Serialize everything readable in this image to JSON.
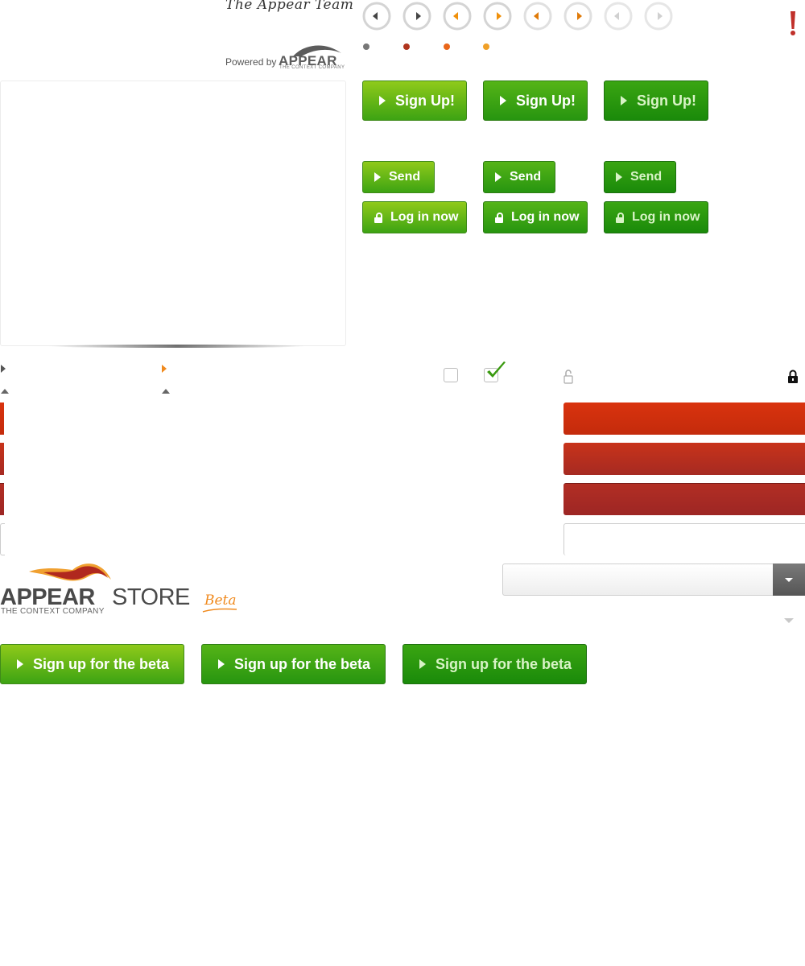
{
  "header": {
    "signature": "The Appear Team",
    "powered_by": "Powered by",
    "brand": "APPEAR",
    "brand_tagline": "THE CONTEXT COMPANY"
  },
  "buttons": {
    "sign_up": "Sign Up!",
    "send": "Send",
    "login": "Log in now",
    "beta": "Sign up for the beta"
  },
  "store_logo": {
    "brand": "APPEAR",
    "store": "STORE",
    "tagline": "THE CONTEXT COMPANY",
    "beta": "Beta"
  },
  "colors": {
    "green_light": "#8fca1a",
    "green_dark": "#1a8a0a",
    "red": "#c42b0c",
    "orange": "#f08a1e",
    "alert_red": "#c0302a"
  },
  "dots": [
    "#777777",
    "#b0351e",
    "#e9661a",
    "#f0a028"
  ]
}
